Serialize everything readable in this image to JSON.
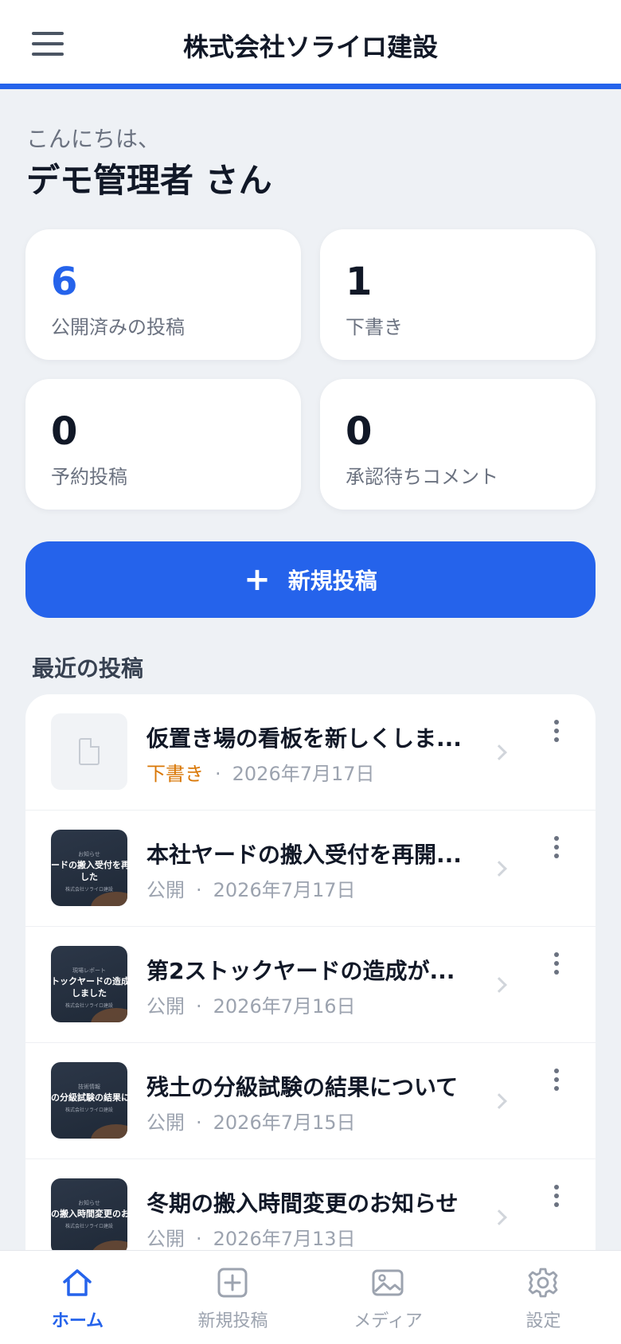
{
  "header": {
    "title": "株式会社ソライロ建設",
    "menu_icon": "hamburger-menu-icon"
  },
  "greeting": {
    "line1": "こんにちは、",
    "name": "デモ管理者 さん"
  },
  "stats": [
    {
      "value": "6",
      "label": "公開済みの投稿",
      "color": "#2563eb"
    },
    {
      "value": "1",
      "label": "下書き"
    },
    {
      "value": "0",
      "label": "予約投稿"
    },
    {
      "value": "0",
      "label": "承認待ちコメント"
    }
  ],
  "new_post_button": {
    "icon": "plus-icon",
    "label": "新規投稿"
  },
  "recent": {
    "title": "最近の投稿",
    "posts": [
      {
        "title": "仮置き場の看板を新しくしま...",
        "status": "下書き",
        "status_color": "#d97706",
        "separator": "·",
        "date": "2026年7月17日",
        "thumb": {
          "type": "placeholder",
          "icon": "document-icon"
        }
      },
      {
        "title": "本社ヤードの搬入受付を再開...",
        "status": "公開",
        "separator": "·",
        "date": "2026年7月17日",
        "thumb": {
          "type": "image",
          "small": "お知らせ",
          "main1": "ードの搬入受付を再",
          "main2": "した",
          "sub": "株式会社ソライロ建設"
        }
      },
      {
        "title": "第2ストックヤードの造成が...",
        "status": "公開",
        "separator": "·",
        "date": "2026年7月16日",
        "thumb": {
          "type": "image",
          "small": "現場レポート",
          "main1": "トックヤードの造成",
          "main2": "しました",
          "sub": "株式会社ソライロ建設"
        }
      },
      {
        "title": "残土の分級試験の結果について",
        "status": "公開",
        "separator": "·",
        "date": "2026年7月15日",
        "thumb": {
          "type": "image",
          "small": "技術情報",
          "main1": "の分級試験の結果につ",
          "main2": "",
          "sub": "株式会社ソライロ建設"
        }
      },
      {
        "title": "冬期の搬入時間変更のお知らせ",
        "status": "公開",
        "separator": "·",
        "date": "2026年7月13日",
        "thumb": {
          "type": "image",
          "small": "お知らせ",
          "main1": "の搬入時間変更のお知",
          "main2": "",
          "sub": "株式会社ソライロ建設"
        }
      }
    ]
  },
  "tabbar": {
    "tabs": [
      {
        "label": "ホーム",
        "icon": "home-icon",
        "active": true
      },
      {
        "label": "新規投稿",
        "icon": "add-square-icon"
      },
      {
        "label": "メディア",
        "icon": "image-icon"
      },
      {
        "label": "設定",
        "icon": "gear-icon"
      }
    ]
  },
  "colors": {
    "accent": "#2563eb",
    "draft": "#d97706",
    "background": "#eef1f5"
  }
}
